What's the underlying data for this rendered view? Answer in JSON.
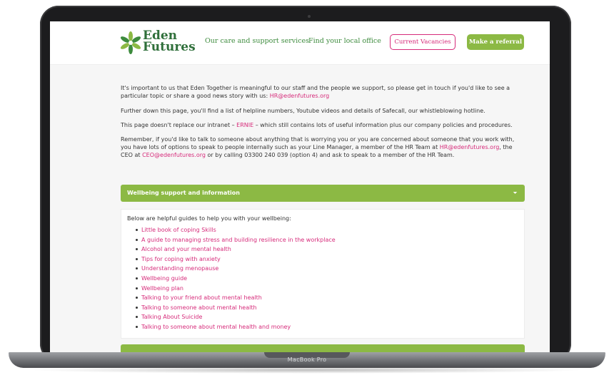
{
  "device": {
    "label": "MacBook Pro"
  },
  "header": {
    "logo_line1": "Eden",
    "logo_line2": "Futures",
    "nav": [
      "Our care and support services",
      "Find your local office"
    ],
    "vacancies_label": "Current Vacancies",
    "referral_label": "Make a referral"
  },
  "intro": {
    "p1_text": "It's important to us that Eden Together is meaningful to our staff and the people we support, so please get in touch if you'd like to see a particular topic or share a good news story with us:",
    "p1_email": "HR@edenfutures.org",
    "p2_text": "Further down this page, you'll find a list of helpline numbers, Youtube videos and details of Safecall, our whistleblowing hotline.",
    "p3_before": "This page doesn't replace our intranet –",
    "p3_link": "ERNIE",
    "p3_after": "– which still contains lots of useful information plus our company policies and procedures.",
    "p4_before": "Remember, if you'd like to talk to someone about anything that is worrying you or you are concerned about someone that you work with, you have lots of options to speak to people internally such as your Line Manager, a member of the HR Team at",
    "p4_email1": "HR@edenfutures.org",
    "p4_mid": ", the CEO at",
    "p4_email2": "CEO@edenfutures.org",
    "p4_after": "or by calling 03300 240 039 (option 4) and ask to speak to a member of the HR Team."
  },
  "accordion": {
    "title": "Wellbeing support and information",
    "intro": "Below are helpful guides to help you with your wellbeing:",
    "items": [
      "Little book of coping Skills",
      "A guide to managing stress and building resilience in the workplace",
      "Alcohol and your mental health",
      "Tips for coping with anxiety",
      "Understanding menopause",
      "Wellbeing guide",
      "Wellbeing plan",
      "Talking to your friend about mental health",
      "Talking to someone about mental health",
      "Talking About Suicide",
      "Talking to someone about mental health and money"
    ]
  },
  "colors": {
    "green": "#8cb944",
    "dark_green": "#2f6f3a",
    "pink": "#d62b7a"
  },
  "icons": {
    "logo": "leaf-star-icon",
    "accordion": "chevron-down-icon",
    "list": "bullet-icon"
  }
}
